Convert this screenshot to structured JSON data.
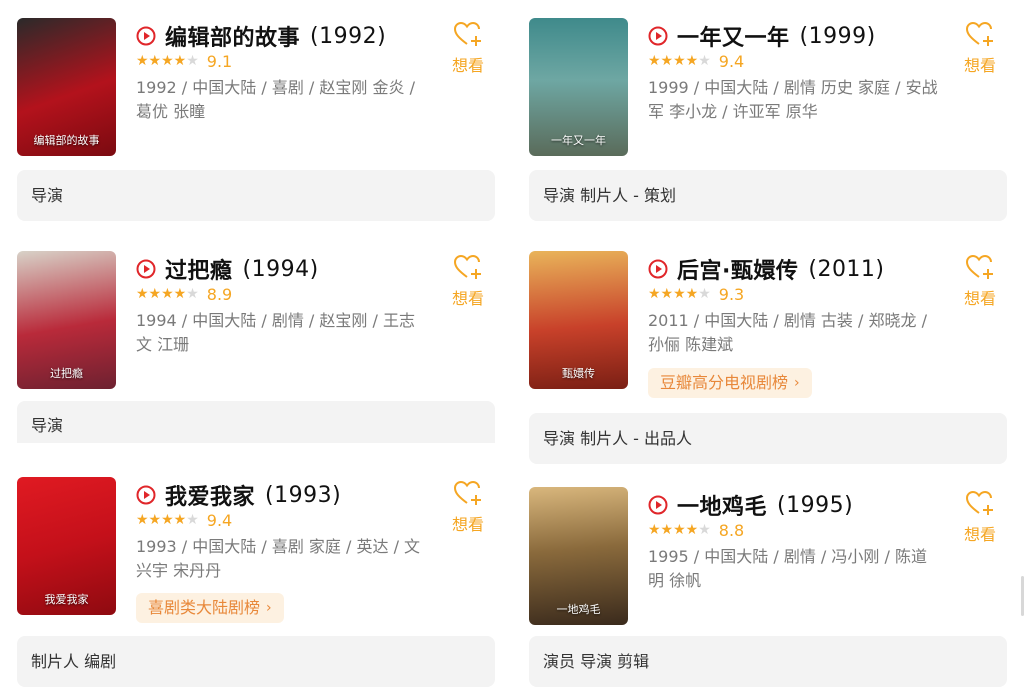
{
  "colors": {
    "accent": "#f5a623",
    "play": "#e0262a",
    "tag_bg": "#fdf1e1",
    "tag_text": "#e8883a",
    "role_bg": "#f3f3f3"
  },
  "want_label": "想看",
  "left": [
    {
      "title": "编辑部的故事",
      "year": "(1992)",
      "score": "9.1",
      "stars": 4.5,
      "meta": "1992 / 中国大陆 / 喜剧 / 赵宝刚 金炎 / 葛优 张瞳",
      "poster_text": "编辑部的故事",
      "roles": "导演"
    },
    {
      "title": "过把瘾",
      "year": "(1994)",
      "score": "8.9",
      "stars": 4.5,
      "meta": "1994 / 中国大陆 / 剧情 / 赵宝刚 / 王志文 江珊",
      "poster_text": "过把瘾",
      "roles": "导演"
    },
    {
      "title": "我爱我家",
      "year": "(1993)",
      "score": "9.4",
      "stars": 4.5,
      "meta": "1993 / 中国大陆 / 喜剧 家庭 / 英达 / 文兴宇 宋丹丹",
      "poster_text": "我爱我家",
      "tag": "喜剧类大陆剧榜",
      "roles": "制片人 编剧"
    }
  ],
  "right": [
    {
      "title": "一年又一年",
      "year": "(1999)",
      "score": "9.4",
      "stars": 4.5,
      "meta": "1999 / 中国大陆 / 剧情 历史 家庭 / 安战军 李小龙 / 许亚军 原华",
      "poster_text": "一年又一年",
      "roles": "导演 制片人 - 策划"
    },
    {
      "title": "后宫·甄嬛传",
      "year": "(2011)",
      "score": "9.3",
      "stars": 4.5,
      "meta": "2011 / 中国大陆 / 剧情 古装 / 郑晓龙 / 孙俪 陈建斌",
      "poster_text": "甄嬛传",
      "tag": "豆瓣高分电视剧榜",
      "roles": "导演 制片人 - 出品人"
    },
    {
      "title": "一地鸡毛",
      "year": "(1995)",
      "score": "8.8",
      "stars": 4.5,
      "meta": "1995 / 中国大陆 / 剧情 / 冯小刚 / 陈道明 徐帆",
      "poster_text": "一地鸡毛",
      "roles": "演员 导演 剪辑"
    }
  ]
}
